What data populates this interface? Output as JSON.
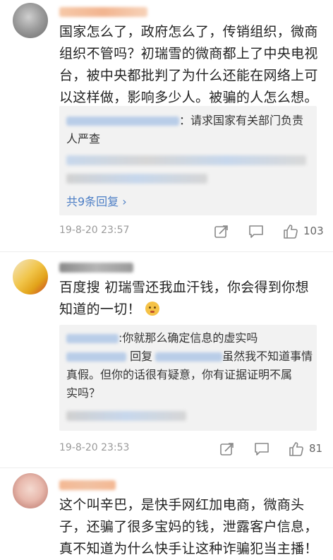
{
  "comments": [
    {
      "text_lines": [
        "国家怎么了，政府怎么了，传销组织，微商",
        "组织不管吗？初瑞雪的微商都上了中央电视",
        "台，被中央都批判了为什么还能在网络上可",
        "以这样做，影响多少人。被骗的人怎么想。"
      ],
      "reply_line1_suffix": "：请求国家有关部门负责",
      "reply_line2": "人严查",
      "more_replies": "共9条回复 ›",
      "time": "19-8-20 23:57",
      "likes": "103"
    },
    {
      "text_lines": [
        "百度搜 初瑞雪还我血汗钱，你会得到你想",
        "知道的一切！"
      ],
      "emoji": "😭",
      "reply1": "你就那么确定信息的虚实吗",
      "reply2_prefix": "回复",
      "reply2_suffix": "虽然我不知道事情",
      "reply2_line2": "真假。但你的话很有疑意，你有证据证明不属",
      "reply2_line3": "实吗？",
      "time": "19-8-20 23:53",
      "likes": "81"
    },
    {
      "text_lines": [
        "这个叫辛巴，是快手网红加电商，微商头",
        "子，还骗了很多宝妈的钱，泄露客户信息，",
        "真不知道为什么快手让这种诈骗犯当主播！"
      ]
    }
  ],
  "icons": [
    "share-icon",
    "comment-icon",
    "like-icon"
  ],
  "colors": {
    "link": "#4c7ec5",
    "reply_bg": "#f2f2f2",
    "meta_text": "#9a9a9a"
  }
}
